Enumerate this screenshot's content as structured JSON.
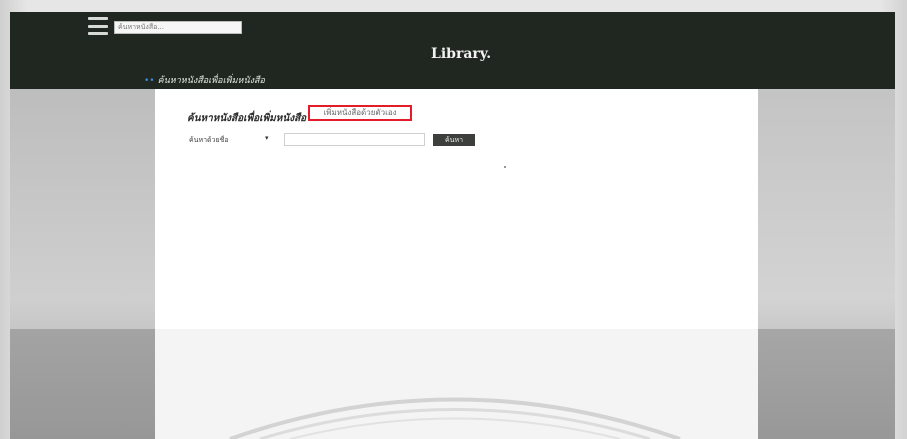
{
  "header": {
    "menu_icon": "hamburger-menu-icon",
    "search_placeholder": "ค้นหาหนังสือ...",
    "title": "Library.",
    "nav_link_label": "ค้นหาหนังสือเพื่อเพิ่มหนังสือ"
  },
  "main": {
    "heading": "ค้นหาหนังสือเพื่อเพิ่มหนังสือ",
    "add_book_link": "เพิ่มหนังสือด้วยตัวเอง",
    "search_by_select": "ค้นหาด้วยชื่อ",
    "search_input_value": "",
    "search_button_label": "ค้นหา"
  },
  "colors": {
    "header_bg": "#202721",
    "highlight_box": "#e31b2b",
    "button_bg": "#3c3f3c",
    "nav_dots": "#3d8ad6"
  }
}
